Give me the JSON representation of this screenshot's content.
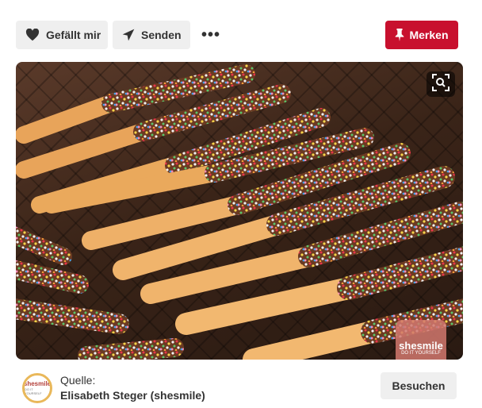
{
  "actions": {
    "like_label": "Gefällt mir",
    "send_label": "Senden",
    "more_label": "•••",
    "save_label": "Merken"
  },
  "colors": {
    "save_red": "#c8102e",
    "button_gray": "#efefef",
    "text_dark": "#333333"
  },
  "icons": {
    "like": "heart-icon",
    "send": "send-icon",
    "save": "pushpin-icon",
    "lens": "visual-search-icon"
  },
  "image": {
    "watermark_name": "shesmile",
    "watermark_sub": "DO IT YOURSELF"
  },
  "source": {
    "label": "Quelle:",
    "name": "Elisabeth Steger (shesmile)",
    "avatar_text": "shesmile",
    "avatar_sub": "DO IT YOURSELF",
    "visit_label": "Besuchen"
  }
}
